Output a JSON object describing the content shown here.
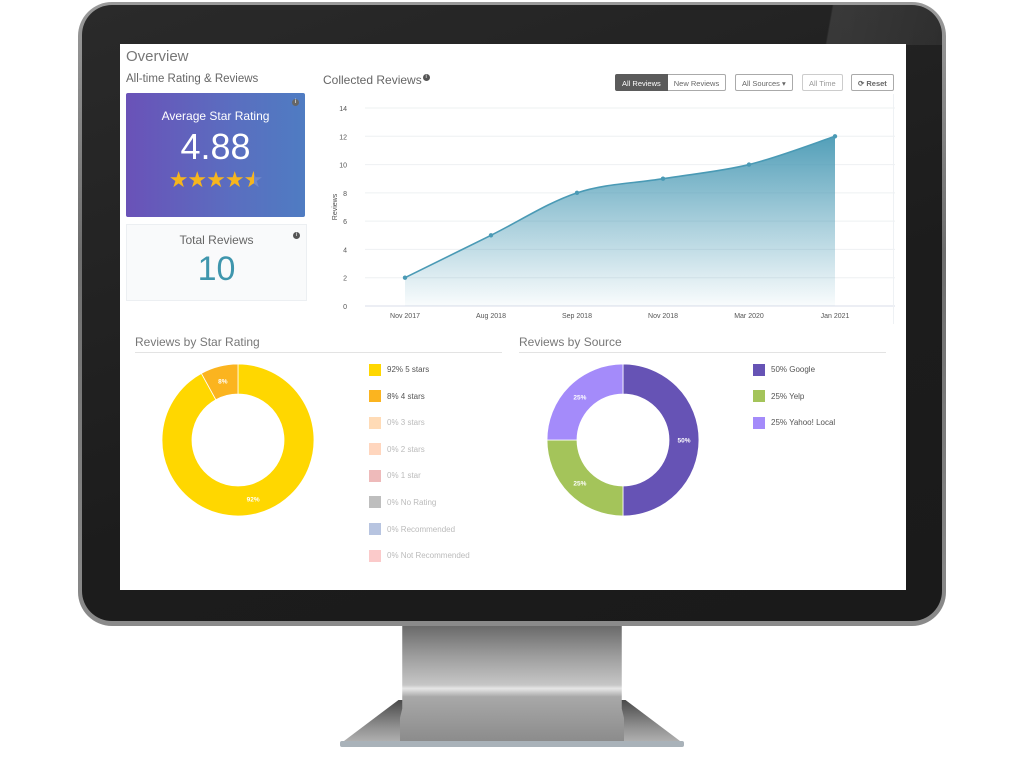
{
  "overview": {
    "title": "Overview",
    "section_label": "All-time Rating & Reviews"
  },
  "average_rating": {
    "label": "Average Star Rating",
    "value": "4.88",
    "stars": 4.88,
    "star_full": "★★★★",
    "star_partial": "★",
    "info_icon": "info-icon"
  },
  "total_reviews": {
    "label": "Total Reviews",
    "value": "10",
    "info_icon": "info-icon"
  },
  "collected_reviews": {
    "title": "Collected Reviews",
    "filters": {
      "review_type": [
        {
          "label": "All Reviews",
          "active": true
        },
        {
          "label": "New Reviews",
          "active": false
        }
      ],
      "sources_label": "All Sources ▾",
      "time_label": "All Time",
      "reset_label": "⟳ Reset"
    }
  },
  "star_rating_section": {
    "title": "Reviews by Star Rating"
  },
  "source_section": {
    "title": "Reviews by Source"
  },
  "colors": {
    "accent_teal": "#3f96ad",
    "line": "#4a9ab5",
    "five_stars": "#ffd700",
    "four_stars": "#fbb41f",
    "three_stars": "#ffcf9e",
    "two_stars": "#ffc8a8",
    "one_star": "#e8a3a3",
    "no_rating": "#a8a8a8",
    "recommended": "#9fb0d6",
    "not_recommended": "#f9b8b8",
    "google": "#6653b5",
    "yelp": "#a4c45a",
    "yahoo": "#a48bfa"
  },
  "chart_data": [
    {
      "type": "area",
      "title": "Collected Reviews",
      "xlabel": "",
      "ylabel": "Reviews",
      "categories": [
        "Nov 2017",
        "Aug 2018",
        "Sep 2018",
        "Nov 2018",
        "Mar 2020",
        "Jan 2021"
      ],
      "values": [
        2,
        5,
        8,
        9,
        10,
        12
      ],
      "ylim": [
        0,
        14
      ],
      "yticks": [
        0,
        2,
        4,
        6,
        8,
        10,
        12,
        14
      ],
      "grid": true
    },
    {
      "type": "pie",
      "title": "Reviews by Star Rating",
      "donut": true,
      "slices": [
        {
          "label": "5 stars",
          "value": 92,
          "display": "92%",
          "legend": "92% 5 stars",
          "color": "#ffd700",
          "muted": false
        },
        {
          "label": "4 stars",
          "value": 8,
          "display": "8%",
          "legend": "8% 4 stars",
          "color": "#fbb41f",
          "muted": false
        },
        {
          "label": "3 stars",
          "value": 0,
          "display": "0%",
          "legend": "0% 3 stars",
          "color": "#ffcf9e",
          "muted": true
        },
        {
          "label": "2 stars",
          "value": 0,
          "display": "0%",
          "legend": "0% 2 stars",
          "color": "#ffc8a8",
          "muted": true
        },
        {
          "label": "1 star",
          "value": 0,
          "display": "0%",
          "legend": "0% 1 star",
          "color": "#e8a3a3",
          "muted": true
        },
        {
          "label": "No Rating",
          "value": 0,
          "display": "0%",
          "legend": "0% No Rating",
          "color": "#a8a8a8",
          "muted": true
        },
        {
          "label": "Recommended",
          "value": 0,
          "display": "0%",
          "legend": "0% Recommended",
          "color": "#9fb0d6",
          "muted": true
        },
        {
          "label": "Not Recommended",
          "value": 0,
          "display": "0%",
          "legend": "0% Not Recommended",
          "color": "#f9b8b8",
          "muted": true
        }
      ],
      "legend_position": "right"
    },
    {
      "type": "pie",
      "title": "Reviews by Source",
      "donut": true,
      "slices": [
        {
          "label": "Google",
          "value": 50,
          "display": "50%",
          "legend": "50% Google",
          "color": "#6653b5",
          "muted": false
        },
        {
          "label": "Yelp",
          "value": 25,
          "display": "25%",
          "legend": "25% Yelp",
          "color": "#a4c45a",
          "muted": false
        },
        {
          "label": "Yahoo! Local",
          "value": 25,
          "display": "25%",
          "legend": "25% Yahoo! Local",
          "color": "#a48bfa",
          "muted": false
        }
      ],
      "legend_position": "right"
    }
  ]
}
